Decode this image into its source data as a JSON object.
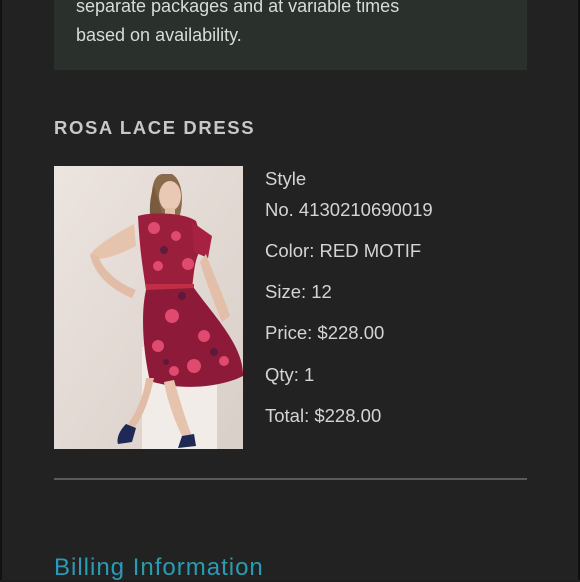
{
  "notice": {
    "line1": "separate packages and at variable times",
    "line2": "based on availability."
  },
  "product": {
    "title": "ROSA LACE DRESS",
    "image_desc": "product-photo-model-red-floral-lace-dress",
    "style_label": "Style",
    "style_no": "No. 4130210690019",
    "color": "Color: RED MOTIF",
    "size": "Size: 12",
    "price": "Price: $228.00",
    "qty": "Qty: 1",
    "total": "Total: $228.00"
  },
  "billing": {
    "heading": "Billing Information"
  },
  "colors": {
    "background": "#222222",
    "notice_bg": "#2a312c",
    "heading_accent": "#2a9bb4",
    "text": "#d4d4d4"
  }
}
